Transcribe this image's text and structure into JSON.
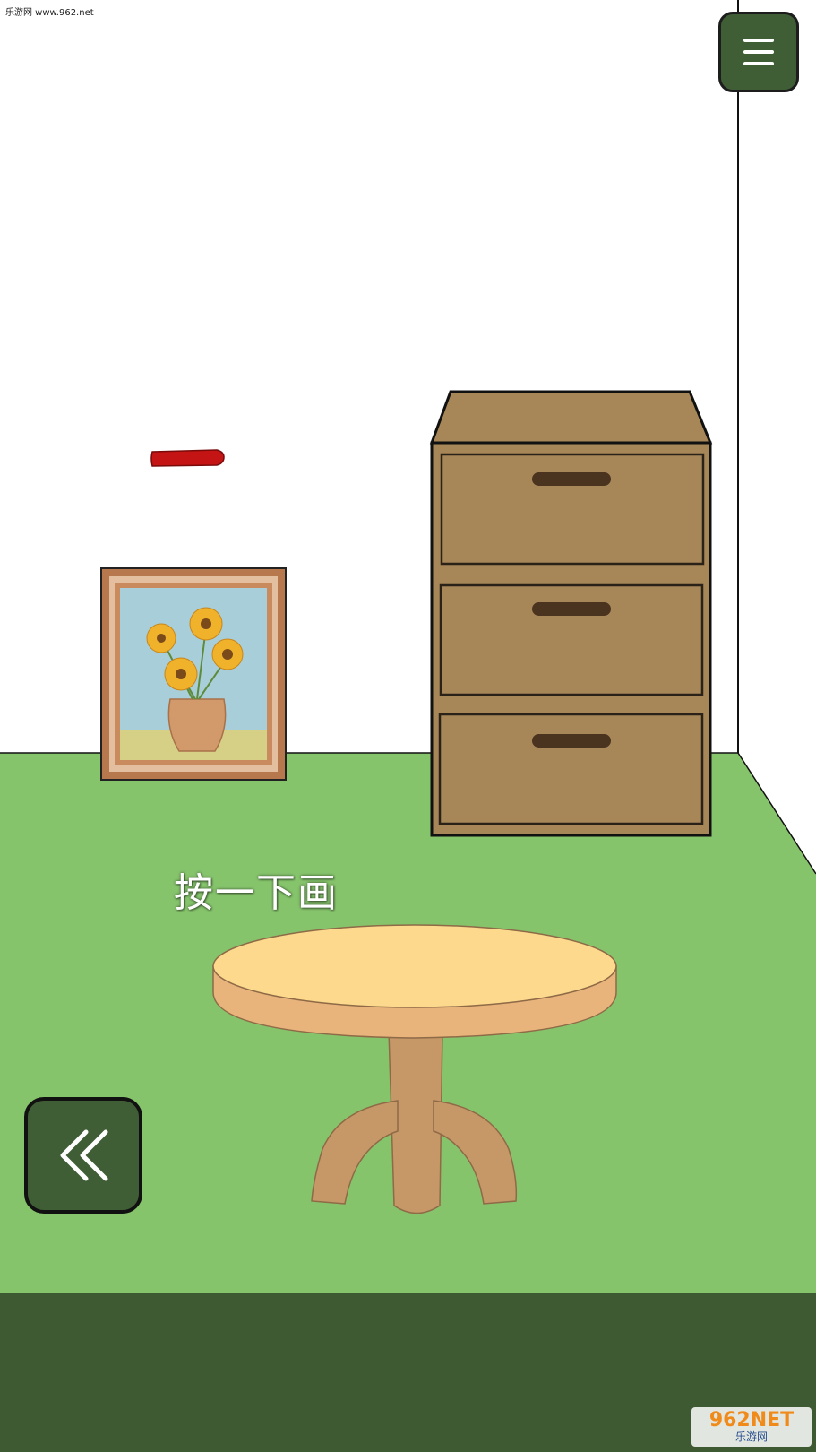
{
  "watermark_top": "乐游网 www.962.net",
  "hint": "按一下画",
  "menu_button": {
    "icon": "hamburger-menu-icon"
  },
  "back_button": {
    "icon": "double-chevron-left-icon"
  },
  "watermark_logo": {
    "brand": "962NET",
    "caption": "乐游网"
  },
  "colors": {
    "wall": "#ffffff",
    "floor": "#86c46c",
    "floor_bottom": "#3e5a32",
    "button": "#3f5e35",
    "cabinet": "#a78758",
    "table_top": "#fcd98d",
    "table_edge": "#e8b47b",
    "table_leg": "#c69767",
    "red_item": "#c41414"
  },
  "scene": {
    "items": [
      "painting-sunflowers",
      "drawer-cabinet",
      "round-table",
      "red-stick"
    ],
    "drawers": 3
  }
}
